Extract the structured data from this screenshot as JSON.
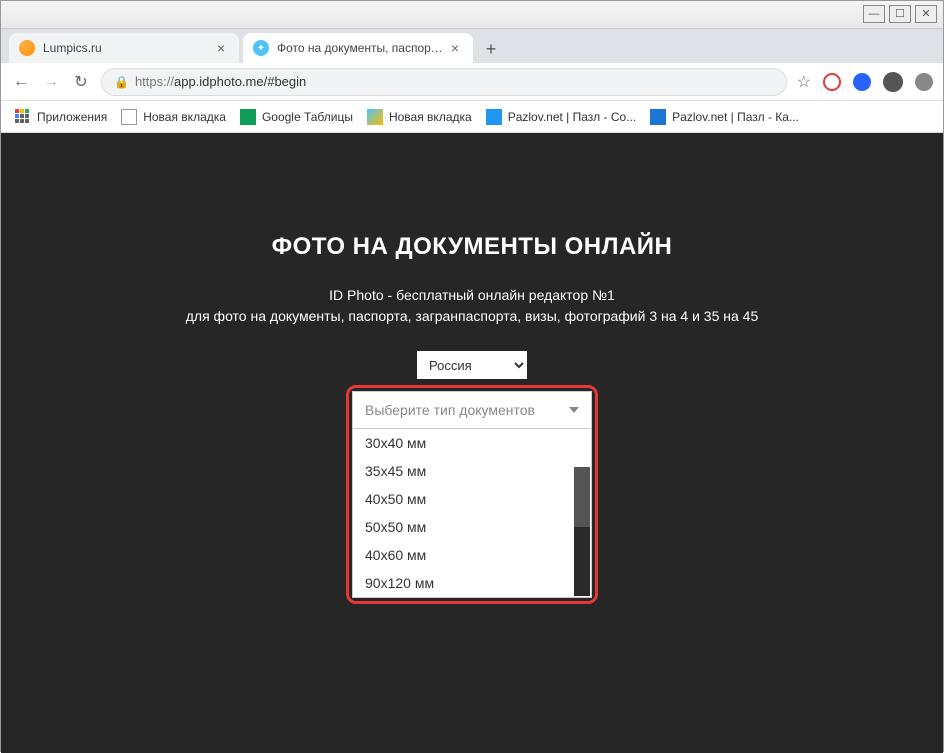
{
  "window": {
    "min": "—",
    "max": "☐",
    "close": "✕"
  },
  "tabs": [
    {
      "title": "Lumpics.ru"
    },
    {
      "title": "Фото на документы, паспорта, з"
    }
  ],
  "newtab": "+",
  "nav": {
    "back": "←",
    "forward": "→",
    "reload": "↻"
  },
  "url": {
    "lock": "🔒",
    "prefix": "https://",
    "rest": "app.idphoto.me/#begin"
  },
  "ext": {
    "star": "☆"
  },
  "bookmarks": [
    {
      "label": "Приложения"
    },
    {
      "label": "Новая вкладка"
    },
    {
      "label": "Google Таблицы"
    },
    {
      "label": "Новая вкладка"
    },
    {
      "label": "Pazlov.net | Пазл - Со..."
    },
    {
      "label": "Pazlov.net | Пазл - Ка..."
    }
  ],
  "page": {
    "heading": "ФОТО НА ДОКУМЕНТЫ ОНЛАЙН",
    "sub1": "ID Photo - бесплатный онлайн редактор №1",
    "sub2": "для фото на документы, паспорта, загранпаспорта, визы, фотографий 3 на 4 и 35 на 45",
    "country": "Россия",
    "doc_placeholder": "Выберите тип документов",
    "options": [
      "30x40 мм",
      "35x45 мм",
      "40x50 мм",
      "50x50 мм",
      "40x60 мм",
      "90x120 мм"
    ]
  }
}
